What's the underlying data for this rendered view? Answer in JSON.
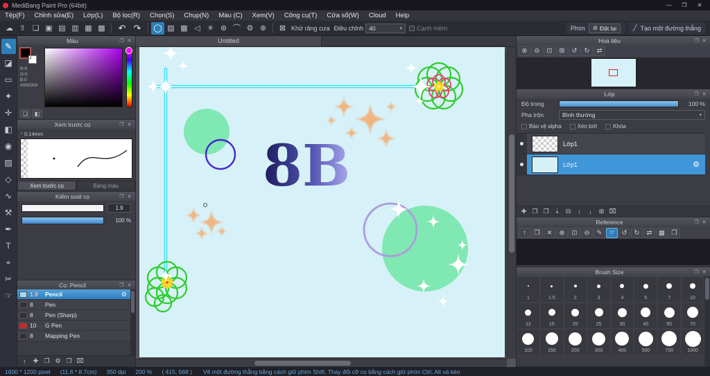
{
  "ui": {
    "popout_glyph": "❐",
    "close_glyph": "✕",
    "dropdown_arrow": "▾"
  },
  "window": {
    "title": "MediBang Paint Pro (64bit)",
    "minimize": "—",
    "maximize": "❐",
    "close": "✕"
  },
  "menu": {
    "items": [
      "Tệp(F)",
      "Chỉnh sửa(E)",
      "Lớp(L)",
      "Bộ lọc(R)",
      "Chọn(S)",
      "Chụp(N)",
      "Màu (C)",
      "Xem(V)",
      "Công cụ(T)",
      "Cửa sổ(W)",
      "Cloud",
      "Help"
    ]
  },
  "toolbar": {
    "file_icons": [
      {
        "name": "cloud-save-icon",
        "glyph": "☁"
      },
      {
        "name": "export-icon",
        "glyph": "⇧"
      },
      {
        "name": "comment-icon",
        "glyph": "❏"
      },
      {
        "name": "image-icon",
        "glyph": "▣"
      },
      {
        "name": "page-icon",
        "glyph": "▤"
      },
      {
        "name": "pages-icon",
        "glyph": "▥"
      },
      {
        "name": "grid-icon",
        "glyph": "▦"
      },
      {
        "name": "table-icon",
        "glyph": "▩"
      }
    ],
    "undo_glyph": "↶",
    "redo_glyph": "↷",
    "option_icons": [
      {
        "name": "brush-shape-circle-icon",
        "glyph": "◯",
        "active": true
      },
      {
        "name": "gradient-icon",
        "glyph": "▨"
      },
      {
        "name": "screen-tone-icon",
        "glyph": "▦"
      },
      {
        "name": "polygon-icon",
        "glyph": "◁"
      },
      {
        "name": "snowflake-icon",
        "glyph": "✳"
      },
      {
        "name": "burst-icon",
        "glyph": "⊛"
      },
      {
        "name": "curve-icon",
        "glyph": "⌒"
      },
      {
        "name": "settings-icon",
        "glyph": "⚙"
      },
      {
        "name": "crosshair-icon",
        "glyph": "⊕"
      }
    ],
    "antialias_glyph": "⊠",
    "antialias_label": "Khử răng cưa",
    "adjust_label": "Điều chỉnh",
    "adjust_value": "40",
    "soft_edge_label": "Cạnh mềm",
    "key_label": "Phím",
    "reset_glyph": "⊘",
    "reset_label": "Đặt lại",
    "mode_glyph": "╱",
    "mode_label": "Tạo một đường thẳng"
  },
  "tools": {
    "items": [
      {
        "name": "brush-tool",
        "glyph": "✎",
        "active": true
      },
      {
        "name": "eraser-tool",
        "glyph": "◪"
      },
      {
        "name": "select-rect-tool",
        "glyph": "▭"
      },
      {
        "name": "magic-wand-tool",
        "glyph": "✦"
      },
      {
        "name": "move-tool",
        "glyph": "✛"
      },
      {
        "name": "transform-tool",
        "glyph": "◧"
      },
      {
        "name": "bucket-tool",
        "glyph": "◉"
      },
      {
        "name": "gradient-tool",
        "glyph": "▨"
      },
      {
        "name": "shape-tool",
        "glyph": "◇"
      },
      {
        "name": "lasso-tool",
        "glyph": "∿"
      },
      {
        "name": "operation-tool",
        "glyph": "⚒"
      },
      {
        "name": "pen-tool",
        "glyph": "✒"
      },
      {
        "name": "text-tool",
        "glyph": "T"
      },
      {
        "name": "snap-tool",
        "glyph": "⌖"
      },
      {
        "name": "divide-tool",
        "glyph": "✂"
      },
      {
        "name": "hand-tool",
        "glyph": "☞"
      }
    ]
  },
  "color_panel": {
    "title": "Màu",
    "r": "R:0",
    "g": "G:0",
    "b": "B:0",
    "hex": "#000000",
    "footer_icons": [
      {
        "name": "color-window-icon",
        "glyph": "❏"
      },
      {
        "name": "color-transparent-icon",
        "glyph": "◧"
      }
    ]
  },
  "preview_panel": {
    "title": "Xem trước cọ",
    "size": "0.14mm",
    "tab_preview": "Xem trước cọ",
    "tab_palette": "Bảng màu"
  },
  "control_panel": {
    "title": "Kiểm soát cọ",
    "size_value": "1.9",
    "opacity_value": "100 %"
  },
  "brush_panel": {
    "title": "Cọ: Pencil",
    "items": [
      {
        "size": "1.9",
        "name": "Pencil",
        "selected": true,
        "swatch": "#a8d8f0"
      },
      {
        "size": "8",
        "name": "Pen"
      },
      {
        "size": "8",
        "name": "Pen (Sharp)"
      },
      {
        "size": "10",
        "name": "G Pen",
        "swatch": "#cc2626"
      },
      {
        "size": "8",
        "name": "Mapping Pen"
      }
    ],
    "footer_icons": [
      {
        "name": "brush-up-icon",
        "glyph": "↑"
      },
      {
        "name": "add-brush-icon",
        "glyph": "✚"
      },
      {
        "name": "duplicate-brush-icon",
        "glyph": "❐"
      },
      {
        "name": "brush-settings-icon",
        "glyph": "⚙"
      },
      {
        "name": "brush-folder-icon",
        "glyph": "❒"
      },
      {
        "name": "delete-brush-icon",
        "glyph": "⌧"
      }
    ]
  },
  "canvas": {
    "tab": "Untitled",
    "art_text": "8B"
  },
  "navigator": {
    "title": "Hoa tiêu",
    "icons": [
      {
        "name": "zoom-in-icon",
        "glyph": "⊕"
      },
      {
        "name": "zoom-out-icon",
        "glyph": "⊖"
      },
      {
        "name": "zoom-fit-icon",
        "glyph": "⊡"
      },
      {
        "name": "zoom-100-icon",
        "glyph": "⊞"
      },
      {
        "name": "rotate-ccw-icon",
        "glyph": "↺"
      },
      {
        "name": "rotate-cw-icon",
        "glyph": "↻"
      },
      {
        "name": "flip-icon",
        "glyph": "⇄"
      }
    ]
  },
  "layer_panel": {
    "title": "Lớp",
    "opacity_label": "Độ trong",
    "opacity_value": "100 %",
    "blend_label": "Pha trộn",
    "blend_value": "Bình thường",
    "checkboxes": [
      {
        "label": "Bảo vệ alpha"
      },
      {
        "label": "Xén bớt"
      },
      {
        "label": "Khóa"
      }
    ],
    "layers": [
      {
        "name": "Lớp1",
        "thumb": "checker",
        "selected": false
      },
      {
        "name": "Lớp1",
        "thumb": "#d6f0f8",
        "selected": true
      }
    ],
    "footer_icons": [
      {
        "name": "new-layer-icon",
        "glyph": "✚"
      },
      {
        "name": "new-folder-icon",
        "glyph": "❒"
      },
      {
        "name": "duplicate-layer-icon",
        "glyph": "❐"
      },
      {
        "name": "transfer-layer-icon",
        "glyph": "⇣"
      },
      {
        "name": "merge-layer-icon",
        "glyph": "⊟"
      },
      {
        "name": "layer-up-icon",
        "glyph": "↑"
      },
      {
        "name": "layer-down-icon",
        "glyph": "↓"
      },
      {
        "name": "layer-property-icon",
        "glyph": "⊞"
      },
      {
        "name": "delete-layer-icon",
        "glyph": "⌧"
      }
    ]
  },
  "reference_panel": {
    "title": "Reference",
    "icons": [
      {
        "name": "ref-up-icon",
        "glyph": "↑"
      },
      {
        "name": "ref-open-icon",
        "glyph": "❒"
      },
      {
        "name": "ref-clear-icon",
        "glyph": "✕"
      },
      {
        "name": "ref-zoom-in-icon",
        "glyph": "⊕"
      },
      {
        "name": "ref-zoom-fit-icon",
        "glyph": "⊡"
      },
      {
        "name": "ref-zoom-out-icon",
        "glyph": "⊖"
      },
      {
        "name": "ref-picker-icon",
        "glyph": "✎"
      },
      {
        "name": "ref-hand-icon",
        "glyph": "☞",
        "active": true
      },
      {
        "name": "ref-rotate-ccw-icon",
        "glyph": "↺"
      },
      {
        "name": "ref-rotate-cw-icon",
        "glyph": "↻"
      },
      {
        "name": "ref-flip-icon",
        "glyph": "⇄"
      },
      {
        "name": "ref-grid-icon",
        "glyph": "▦"
      },
      {
        "name": "ref-popout-icon",
        "glyph": "❐"
      }
    ]
  },
  "brush_size_panel": {
    "title": "Brush Size",
    "sizes": [
      "1",
      "1.5",
      "2",
      "3",
      "4",
      "5",
      "7",
      "10",
      "12",
      "15",
      "20",
      "25",
      "30",
      "40",
      "50",
      "70",
      "100",
      "150",
      "200",
      "300",
      "400",
      "500",
      "700",
      "1000"
    ]
  },
  "statusbar": {
    "segments": [
      "1600 * 1200 pixel",
      "(11.6 * 8.7cm)",
      "350 dpi",
      "200 %",
      "( 415, 568 )"
    ],
    "hint": "Vẽ một đường thẳng bằng cách giữ phím Shift, Thay đổi cỡ cọ bằng cách giữ phím Ctrl, Alt và kéo"
  }
}
